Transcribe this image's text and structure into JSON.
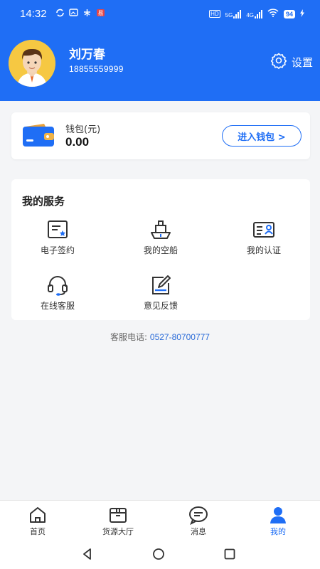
{
  "status_bar": {
    "time": "14:32",
    "battery": "94",
    "net1": "5G",
    "net2": "4G"
  },
  "profile": {
    "name": "刘万春",
    "phone": "18855559999",
    "settings_label": "设置"
  },
  "wallet": {
    "label": "钱包(元)",
    "amount": "0.00",
    "enter_button": "进入钱包 >"
  },
  "services": {
    "title": "我的服务",
    "items": [
      {
        "label": "电子签约",
        "icon": "contract-icon"
      },
      {
        "label": "我的空船",
        "icon": "ship-icon"
      },
      {
        "label": "我的认证",
        "icon": "id-card-icon"
      },
      {
        "label": "在线客服",
        "icon": "headset-icon"
      },
      {
        "label": "意见反馈",
        "icon": "feedback-icon"
      }
    ]
  },
  "hotline": {
    "label": "客服电话:",
    "number": "0527-80700777"
  },
  "tabs": [
    {
      "label": "首页",
      "icon": "home-icon",
      "active": false
    },
    {
      "label": "货源大厅",
      "icon": "cargo-icon",
      "active": false
    },
    {
      "label": "消息",
      "icon": "message-icon",
      "active": false
    },
    {
      "label": "我的",
      "icon": "profile-icon",
      "active": true
    }
  ],
  "colors": {
    "primary": "#1f6ef5",
    "link": "#2a6bd8"
  }
}
